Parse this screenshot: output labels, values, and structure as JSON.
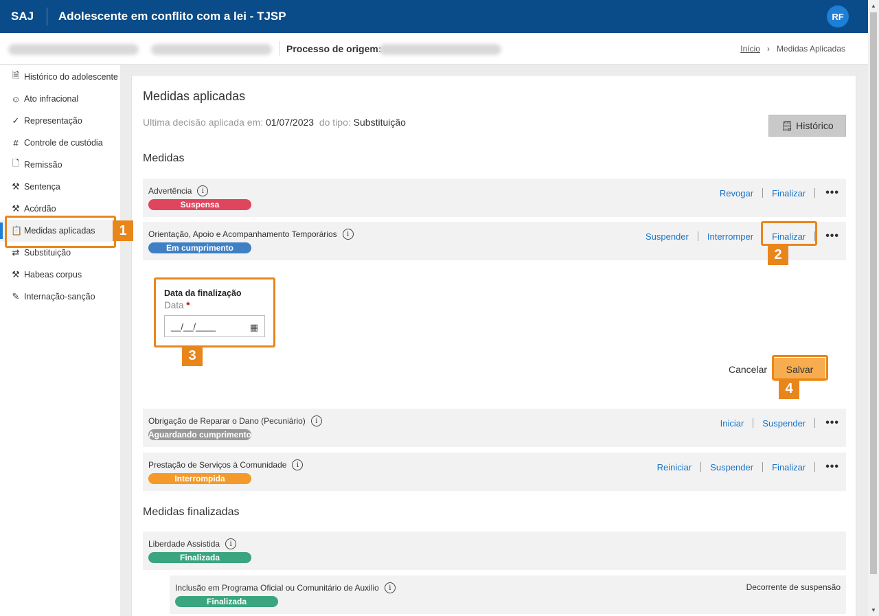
{
  "header": {
    "brand": "SAJ",
    "title": "Adolescente em conflito com a lei - TJSP",
    "avatar_initials": "RF"
  },
  "subheader": {
    "processo_label": "Processo de origem:"
  },
  "breadcrumb": {
    "home": "Início",
    "current": "Medidas Aplicadas"
  },
  "sidebar": {
    "items": [
      {
        "label": "Histórico do adolescente",
        "icon": "document-icon"
      },
      {
        "label": "Ato infracional",
        "icon": "person-icon"
      },
      {
        "label": "Representação",
        "icon": "check-icon"
      },
      {
        "label": "Controle de custódia",
        "icon": "grid-icon"
      },
      {
        "label": "Remissão",
        "icon": "document-search-icon"
      },
      {
        "label": "Sentença",
        "icon": "gavel-icon"
      },
      {
        "label": "Acórdão",
        "icon": "gavel-icon"
      },
      {
        "label": "Medidas aplicadas",
        "icon": "clipboard-icon"
      },
      {
        "label": "Substituição",
        "icon": "swap-icon"
      },
      {
        "label": "Habeas corpus",
        "icon": "gavel-icon"
      },
      {
        "label": "Internação-sanção",
        "icon": "document-edit-icon"
      }
    ]
  },
  "main": {
    "title": "Medidas aplicadas",
    "last_decision_label": "Ultima decisão aplicada em:",
    "last_decision_date": "01/07/2023",
    "type_label": "do tipo:",
    "type_value": "Substituição",
    "history_button": "Histórico",
    "medidas_title": "Medidas",
    "finalizadas_title": "Medidas finalizadas"
  },
  "medidas": [
    {
      "name": "Advertência",
      "status": "Suspensa",
      "status_color": "#e0455e",
      "actions": [
        "Revogar",
        "Finalizar"
      ]
    },
    {
      "name": "Orientação, Apoio e Acompanhamento Temporários",
      "status": "Em cumprimento",
      "status_color": "#3f7fc4",
      "actions": [
        "Suspender",
        "Interromper",
        "Finalizar"
      ]
    },
    {
      "name": "Obrigação de Reparar o Dano (Pecuniário)",
      "status": "Aguardando cumprimento",
      "status_color": "#999999",
      "actions": [
        "Iniciar",
        "Suspender"
      ]
    },
    {
      "name": "Prestação de Serviços à Comunidade",
      "status": "Interrompida",
      "status_color": "#f39a2b",
      "actions": [
        "Reiniciar",
        "Suspender",
        "Finalizar"
      ]
    }
  ],
  "finalizadas": [
    {
      "name": "Liberdade Assistida",
      "status": "Finalizada",
      "status_color": "#3aa57f"
    },
    {
      "name": "Inclusão em Programa Oficial ou Comunitário de Auxilio",
      "status": "Finalizada",
      "status_color": "#3aa57f",
      "note": "Decorrente de suspensão"
    }
  ],
  "form": {
    "section_label": "Data da finalização",
    "field_label": "Data",
    "required_mark": "*",
    "date_placeholder": "__/__/____",
    "cancel": "Cancelar",
    "save": "Salvar"
  },
  "callouts": [
    "1",
    "2",
    "3",
    "4"
  ],
  "colors": {
    "header": "#0a4c89",
    "accent": "#1e7fd6",
    "link": "#1a73c7",
    "callout": "#e8861c",
    "save": "#f7ad4f"
  }
}
